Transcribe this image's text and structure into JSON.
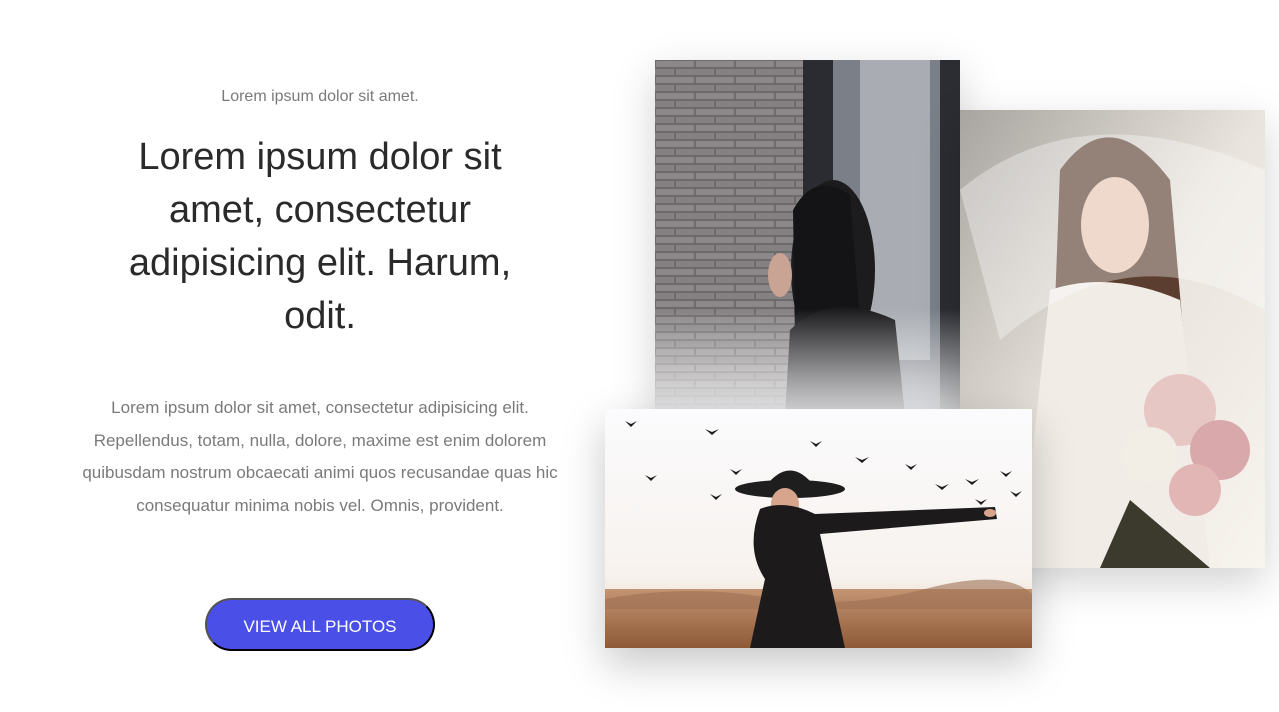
{
  "hero": {
    "eyebrow": "Lorem ipsum dolor sit amet.",
    "headline": "Lorem ipsum dolor sit amet, consectetur adipisicing elit. Harum, odit.",
    "body": "Lorem ipsum dolor sit amet, consectetur adipisicing elit. Repellendus, totam, nulla, dolore, maxime est enim dolorem quibusdam nostrum obcaecati animi quos recusandae quas hic consequatur minima nobis vel. Omnis, provident.",
    "cta_label": "VIEW ALL PHOTOS"
  },
  "colors": {
    "accent": "#4a4fe8",
    "heading": "#2a2a2a",
    "muted": "#7a7a7a"
  },
  "gallery": {
    "photos": [
      {
        "name": "woman-brick-wall-photo"
      },
      {
        "name": "woman-veil-flowers-photo"
      },
      {
        "name": "woman-hat-birds-field-photo"
      }
    ]
  }
}
